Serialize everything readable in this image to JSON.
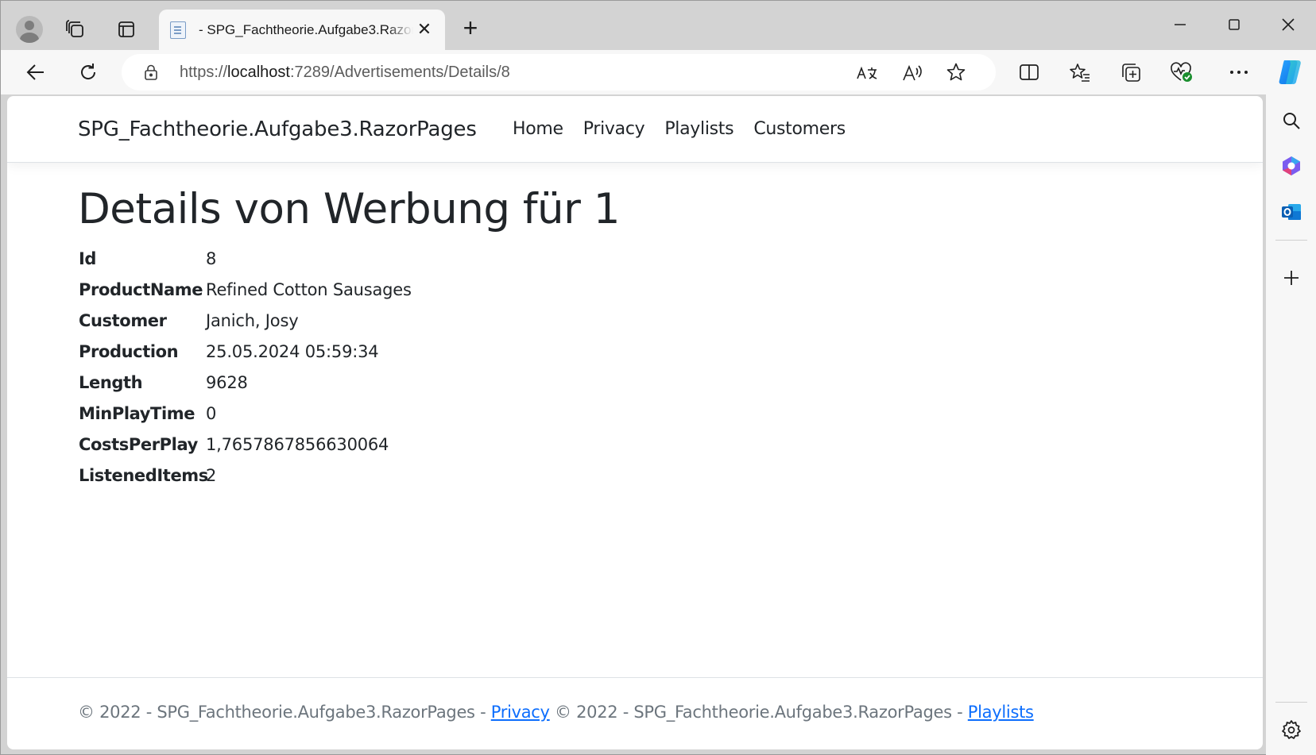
{
  "tab": {
    "title": "- SPG_Fachtheorie.Aufgabe3.RazorPages",
    "close_glyph": "✕",
    "new_tab_glyph": "+"
  },
  "window_controls": {
    "minimize": "—",
    "maximize": "☐",
    "close": "✕"
  },
  "address": {
    "scheme": "https://",
    "host": "localhost",
    "path": ":7289/Advertisements/Details/8"
  },
  "site": {
    "brand": "SPG_Fachtheorie.Aufgabe3.RazorPages",
    "nav": [
      "Home",
      "Privacy",
      "Playlists",
      "Customers"
    ]
  },
  "page": {
    "title": "Details von Werbung für 1",
    "details": [
      {
        "label": "Id",
        "value": "8"
      },
      {
        "label": "ProductName",
        "value": "Refined Cotton Sausages"
      },
      {
        "label": "Customer",
        "value": "Janich, Josy"
      },
      {
        "label": "Production",
        "value": "25.05.2024 05:59:34"
      },
      {
        "label": "Length",
        "value": "9628"
      },
      {
        "label": "MinPlayTime",
        "value": "0"
      },
      {
        "label": "CostsPerPlay",
        "value": "1,7657867856630064"
      },
      {
        "label": "ListenedItems",
        "value": "2"
      }
    ]
  },
  "footer": {
    "text1": "© 2022 - SPG_Fachtheorie.Aufgabe3.RazorPages - ",
    "link1": "Privacy",
    "text2": " © 2022 - SPG_Fachtheorie.Aufgabe3.RazorPages - ",
    "link2": "Playlists"
  },
  "icons": {
    "toolbar": [
      "back-arrow-icon",
      "refresh-icon",
      "lock-icon",
      "translate-icon",
      "read-aloud-icon",
      "favorite-star-icon",
      "split-screen-icon",
      "favorites-icon",
      "collections-icon",
      "browser-essentials-icon",
      "more-icon",
      "copilot-icon"
    ],
    "sidebar": [
      "search-icon",
      "office-icon",
      "outlook-icon",
      "add-icon",
      "settings-icon"
    ]
  },
  "colors": {
    "link": "#0d6efd",
    "text": "#212529",
    "muted": "#6c757d",
    "frame": "#d3d3d3",
    "toolbar": "#f7f7f7"
  }
}
